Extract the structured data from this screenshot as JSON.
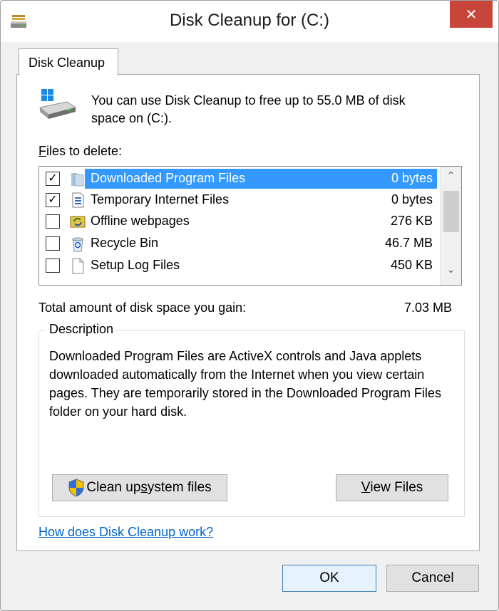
{
  "window": {
    "title": "Disk Cleanup for  (C:)",
    "close_label": "✕"
  },
  "tab": {
    "label": "Disk Cleanup"
  },
  "intro": {
    "text_line1": "You can use Disk Cleanup to free up to 55.0 MB of disk",
    "text_line2": "space on  (C:)."
  },
  "files": {
    "label_prefix": "",
    "label_accel": "F",
    "label_rest": "iles to delete:",
    "items": [
      {
        "checked": true,
        "checkmark": "✓",
        "name": "Downloaded Program Files",
        "size": "0 bytes",
        "icon": "folder-icon",
        "selected": true
      },
      {
        "checked": true,
        "checkmark": "✓",
        "name": "Temporary Internet Files",
        "size": "0 bytes",
        "icon": "document-icon",
        "selected": false
      },
      {
        "checked": false,
        "checkmark": "",
        "name": "Offline webpages",
        "size": "276 KB",
        "icon": "sync-folder-icon",
        "selected": false
      },
      {
        "checked": false,
        "checkmark": "",
        "name": "Recycle Bin",
        "size": "46.7 MB",
        "icon": "recycle-bin-icon",
        "selected": false
      },
      {
        "checked": false,
        "checkmark": "",
        "name": "Setup Log Files",
        "size": "450 KB",
        "icon": "file-icon",
        "selected": false
      }
    ]
  },
  "total": {
    "label": "Total amount of disk space you gain:",
    "value": "7.03 MB"
  },
  "description": {
    "legend": "Description",
    "text": "Downloaded Program Files are ActiveX controls and Java applets downloaded automatically from the Internet when you view certain pages. They are temporarily stored in the Downloaded Program Files folder on your hard disk."
  },
  "buttons": {
    "cleanup_system_prefix": "Clean up ",
    "cleanup_system_accel": "s",
    "cleanup_system_rest": "ystem files",
    "view_files_accel": "V",
    "view_files_rest": "iew Files",
    "ok": "OK",
    "cancel": "Cancel"
  },
  "help_link": "How does Disk Cleanup work?",
  "colors": {
    "selection": "#3399ff",
    "close": "#c7453b",
    "link": "#0066cc"
  }
}
